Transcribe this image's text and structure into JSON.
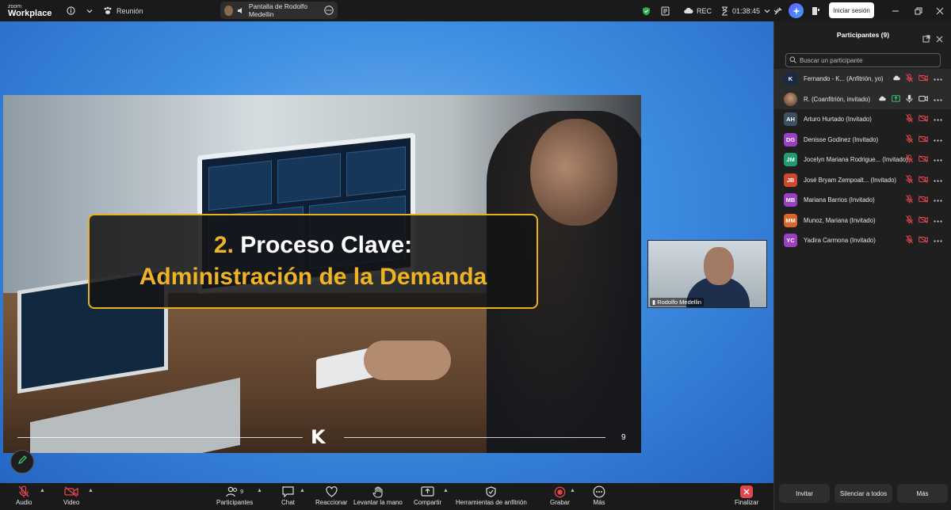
{
  "app": {
    "brand_top": "zoom",
    "brand_bottom": "Workplace"
  },
  "topbar": {
    "meeting_label": "Reunión",
    "share_label": "Pantalla de Rodolfo Medellin",
    "rec_label": "REC",
    "timer": "01:38:45",
    "signin_label": "Iniciar sesión"
  },
  "slide": {
    "title_number": "2.",
    "title_line1": "Proceso Clave:",
    "title_line2": "Administración de la Demanda",
    "page_number": "9",
    "logo_letter": "K"
  },
  "video_tile": {
    "name": "Rodolfo Medellin"
  },
  "toolbar": {
    "audio": "Audio",
    "video": "Video",
    "participants": "Participantes",
    "participants_count": "9",
    "chat": "Chat",
    "react": "Reaccionar",
    "raise_hand": "Levantar la mano",
    "share": "Compartir",
    "host_tools": "Herramientas de anfitrión",
    "record": "Grabar",
    "more": "Más",
    "end": "Finalizar"
  },
  "panel": {
    "title": "Participantes (9)",
    "search_placeholder": "Buscar un participante",
    "participants": [
      {
        "initials": "K",
        "name": "Fernando - K...  (Anfitrión, yo)",
        "color": "#1a2a44"
      },
      {
        "initials": "",
        "name": "R. (Coanfitrión, invitado)",
        "color": "#8a6a4e"
      },
      {
        "initials": "AH",
        "name": "Arturo Hurtado (Invitado)",
        "color": "#3d4f63"
      },
      {
        "initials": "DG",
        "name": "Denisse Godinez (Invitado)",
        "color": "#9b3fc4"
      },
      {
        "initials": "JM",
        "name": "Jocelyn Mariana Rodrigue...  (Invitado)",
        "color": "#1f9c73"
      },
      {
        "initials": "JB",
        "name": "José Bryam Zempoalt...  (Invitado)",
        "color": "#d0472d"
      },
      {
        "initials": "MB",
        "name": "Mariana Barrios (Invitado)",
        "color": "#9b3fc4"
      },
      {
        "initials": "MM",
        "name": "Munoz, Mariana (Invitado)",
        "color": "#d9672a"
      },
      {
        "initials": "YC",
        "name": "Yadira Carmona (Invitado)",
        "color": "#9b3fc4"
      }
    ],
    "invite": "Invitar",
    "mute_all": "Silenciar a todos",
    "more": "Más"
  },
  "colors": {
    "accent": "#f0b323",
    "muted_red": "#e0474c",
    "stage_blue": "#3f8fe3"
  }
}
